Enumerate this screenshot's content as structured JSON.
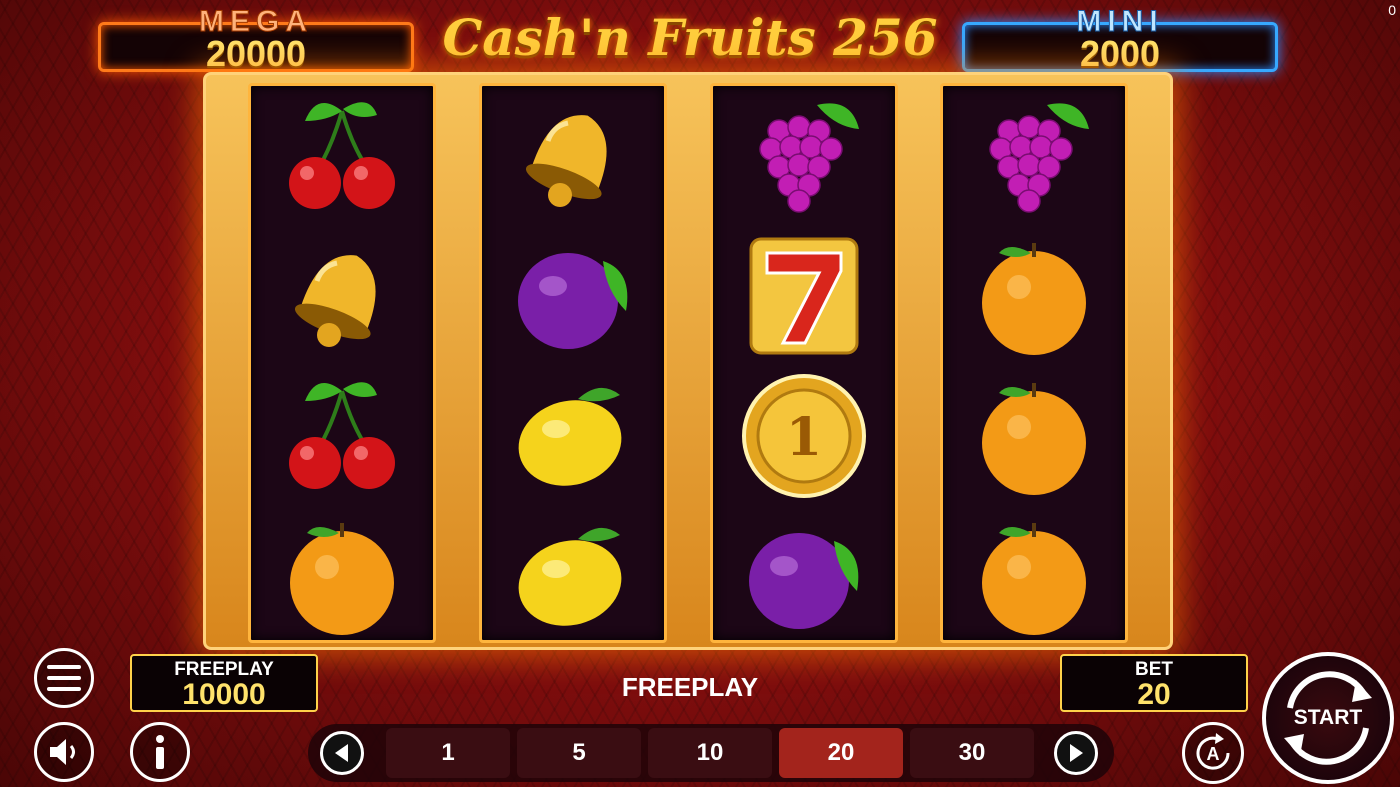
{
  "corner_counter": "0",
  "jackpots": {
    "mega": {
      "label": "MEGA",
      "value": "20000"
    },
    "mini": {
      "label": "MINI",
      "value": "2000"
    }
  },
  "title": "Cash'n Fruits 256",
  "reels": [
    [
      "cherry",
      "bell",
      "cherry",
      "orange"
    ],
    [
      "bell",
      "plum",
      "lemon",
      "lemon"
    ],
    [
      "grapes",
      "seven",
      "coin",
      "plum"
    ],
    [
      "grapes",
      "orange",
      "orange",
      "orange"
    ]
  ],
  "coin_value": "1",
  "balance": {
    "label": "FREEPLAY",
    "value": "10000"
  },
  "status_text": "FREEPLAY",
  "bet": {
    "label": "BET",
    "value": "20"
  },
  "bet_options": [
    "1",
    "5",
    "10",
    "20",
    "30"
  ],
  "selected_bet": "20",
  "start_label": "START",
  "icons": [
    "menu-icon",
    "sound-icon",
    "info-icon",
    "autoplay-icon",
    "arrow-left-icon",
    "arrow-right-icon"
  ],
  "colors": {
    "selected_bet": "#a3241c",
    "jackpot_mega": "#ff7a1a",
    "jackpot_mini": "#37a8ff",
    "value_text": "#ffe26b"
  }
}
